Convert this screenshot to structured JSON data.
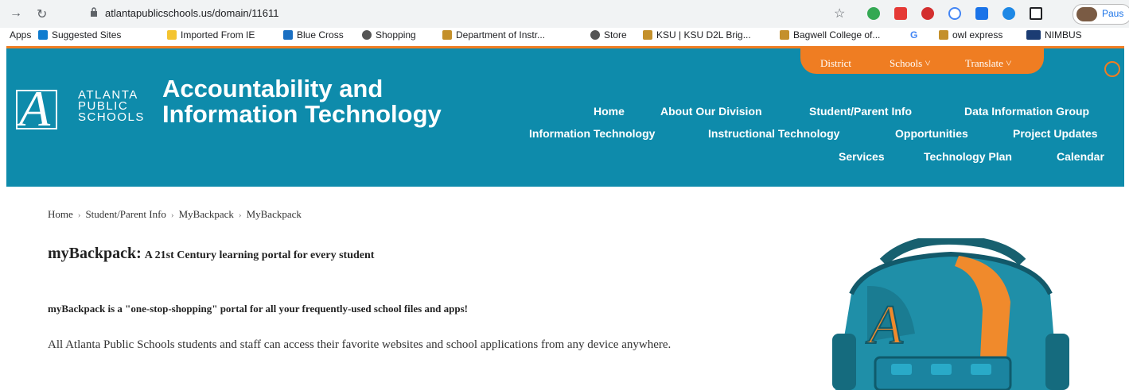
{
  "browser": {
    "url": "atlantapublicschools.us/domain/11611",
    "profile_label": "Paus",
    "bookmarks": [
      {
        "label": "Apps",
        "color": "#ffffff"
      },
      {
        "label": "Suggested Sites",
        "color": "#0f7ccf"
      },
      {
        "label": "Imported From IE",
        "color": "#f4c430"
      },
      {
        "label": "Blue Cross",
        "color": "#1a6fc2"
      },
      {
        "label": "Shopping",
        "color": "#555555"
      },
      {
        "label": "Department of Instr...",
        "color": "#c4902b"
      },
      {
        "label": "Store",
        "color": "#555555"
      },
      {
        "label": "KSU | KSU D2L Brig...",
        "color": "#c4902b"
      },
      {
        "label": "Bagwell College of...",
        "color": "#c4902b"
      },
      {
        "label": "",
        "color": "#4285f4"
      },
      {
        "label": "owl express",
        "color": "#c4902b"
      },
      {
        "label": "NIMBUS",
        "color": "#1b3c73"
      }
    ],
    "extensions": [
      "#34a853",
      "#e53935",
      "#d32f2f",
      "#4285f4",
      "#1a73e8",
      "#1e88e5",
      "#202124"
    ]
  },
  "header": {
    "logo_lines": [
      "ATLANTA",
      "PUBLIC",
      "SCHOOLS"
    ],
    "logo_letter": "A",
    "title": "Accountability and Information Technology",
    "utility": {
      "district": "District",
      "schools": "Schools ˅",
      "translate": "Translate ˅"
    },
    "nav_row1": [
      "Home",
      "About Our Division",
      "Student/Parent Info",
      "Data Information Group"
    ],
    "nav_row2": [
      "Information Technology",
      "Instructional Technology",
      "Opportunities",
      "Project Updates"
    ],
    "nav_row3": [
      "Services",
      "Technology Plan",
      "Calendar"
    ],
    "colors": {
      "teal": "#0e8bab",
      "orange": "#ef7d22"
    }
  },
  "breadcrumb": [
    "Home",
    "Student/Parent Info",
    "MyBackpack",
    "MyBackpack"
  ],
  "content": {
    "heading_main": "myBackpack:",
    "heading_sub": "A 21st Century learning portal for every student",
    "intro": "myBackpack is a \"one-stop-shopping\" portal for all your frequently-used school files and apps!",
    "body": "All Atlanta Public Schools students and staff can access their favorite websites and school applications from any device anywhere."
  }
}
